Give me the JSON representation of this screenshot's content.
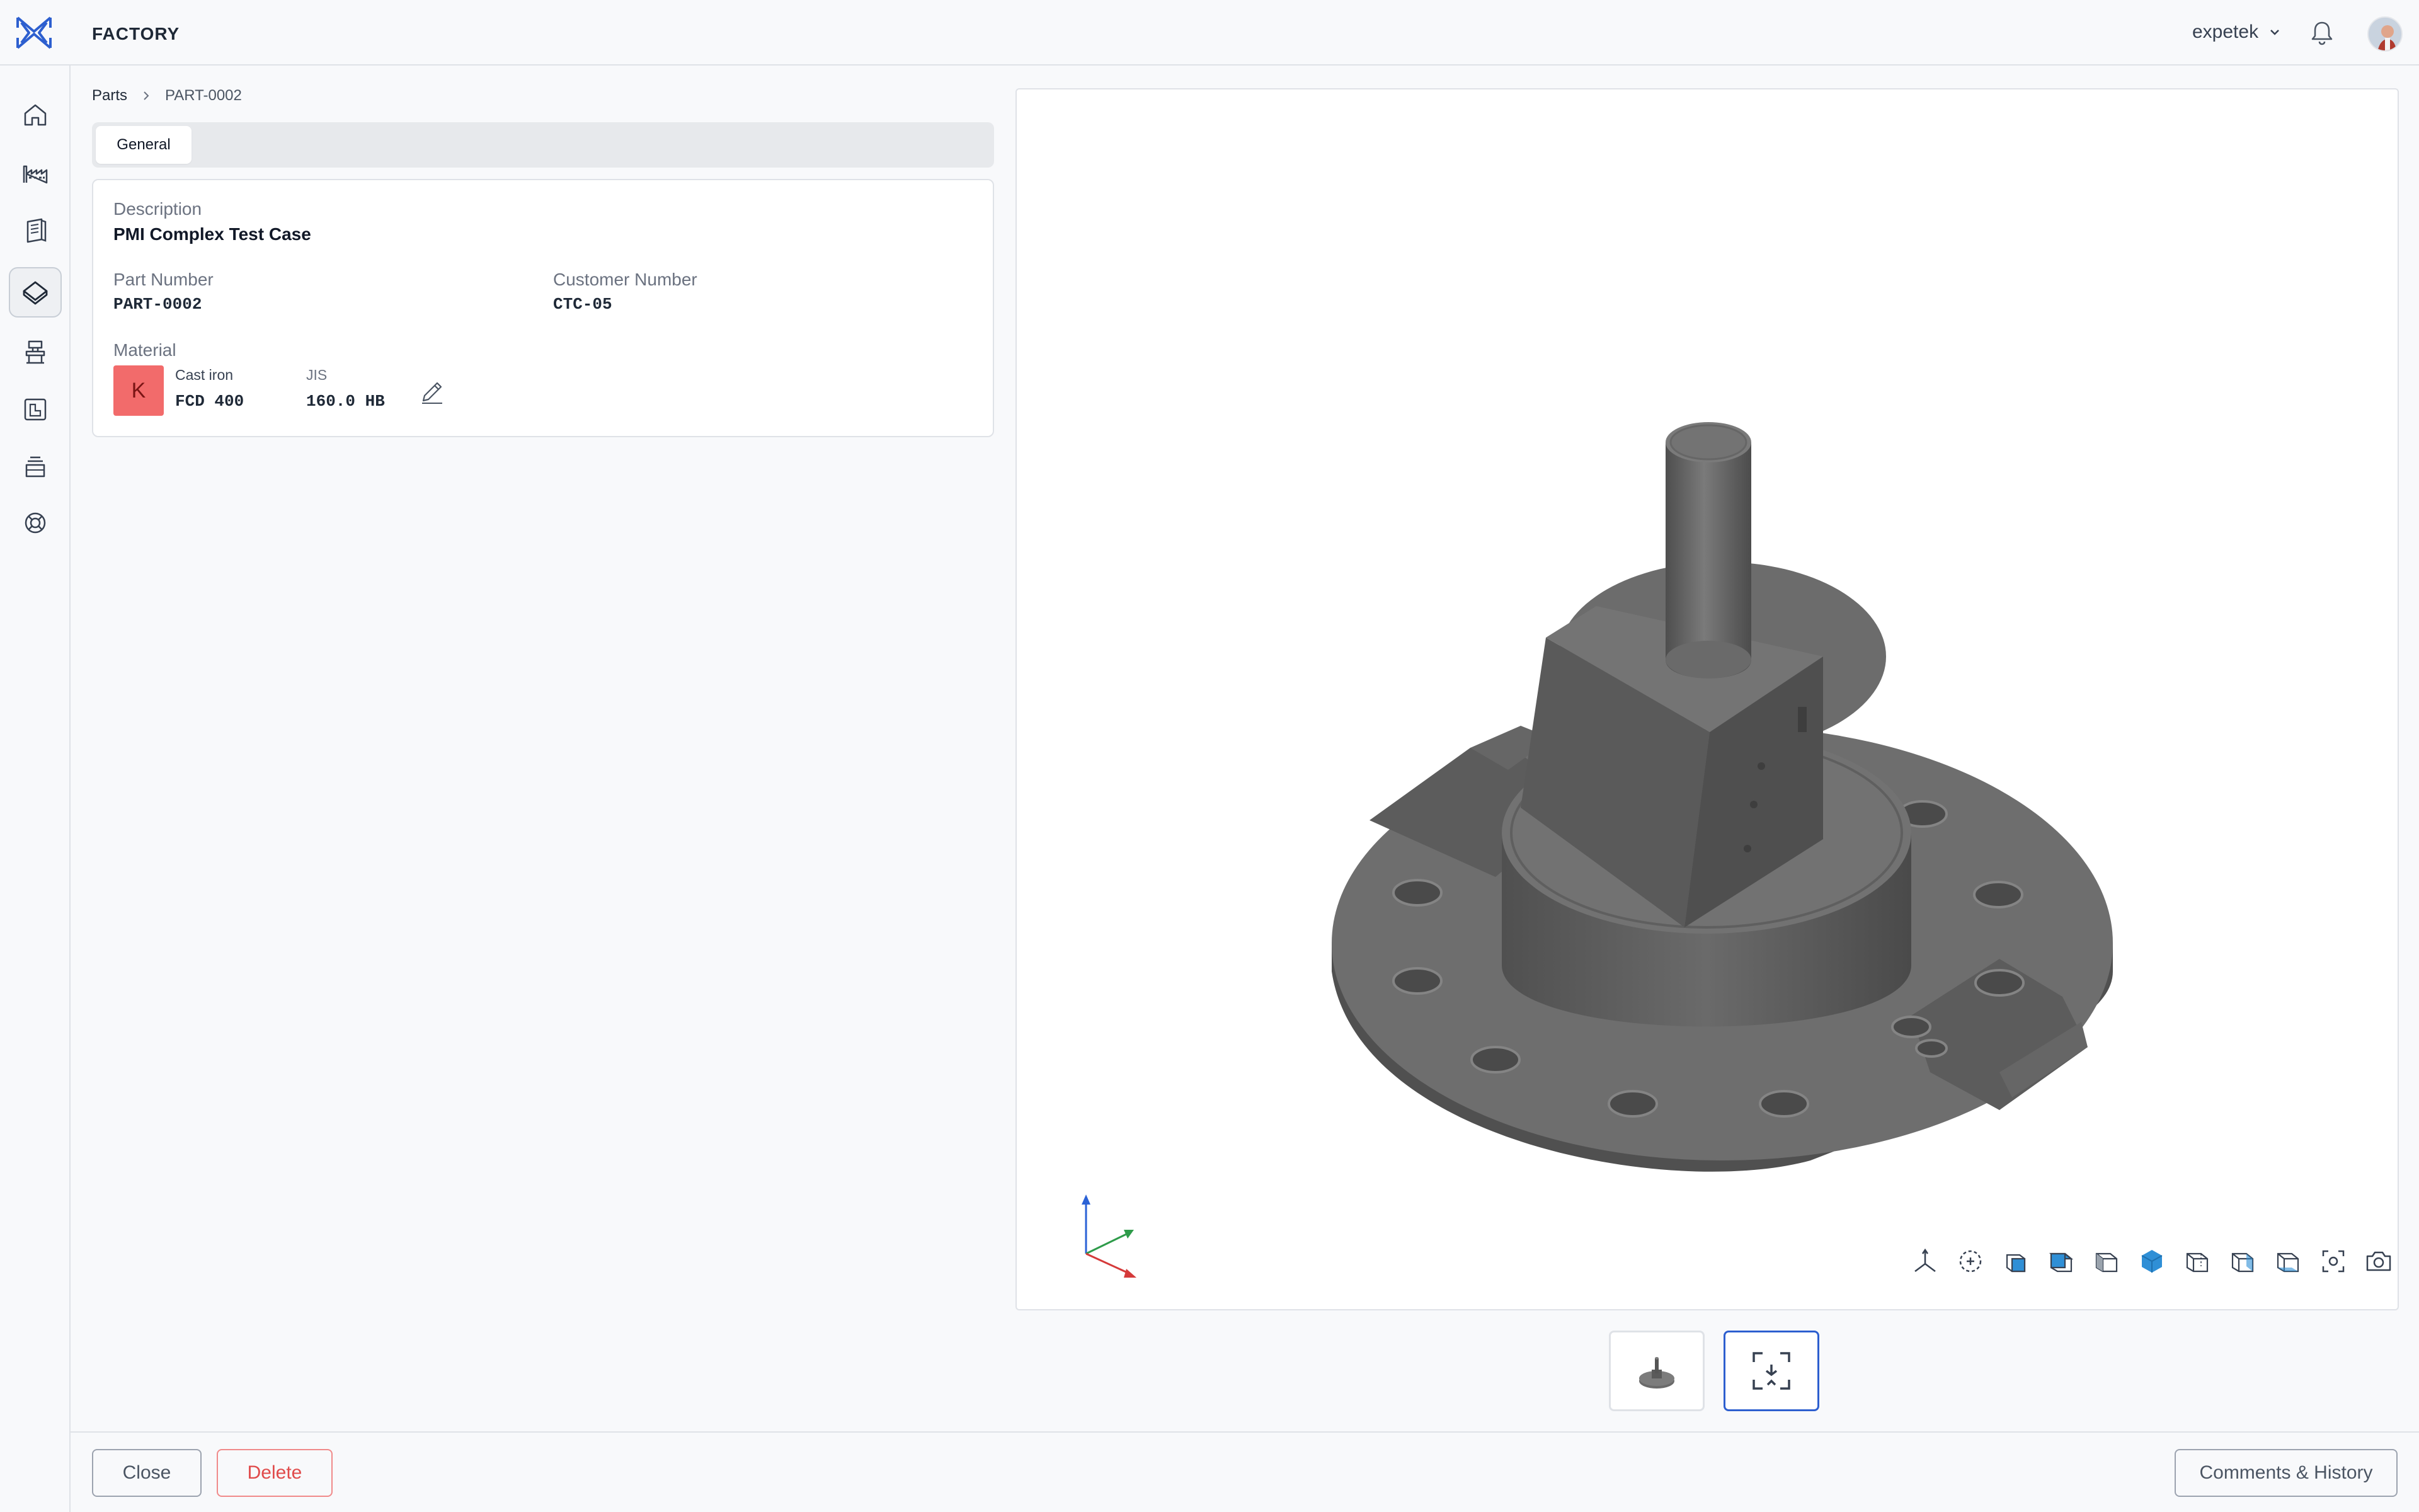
{
  "app": {
    "title": "FACTORY"
  },
  "user": {
    "name": "expetek"
  },
  "nav": {
    "items": [
      {
        "icon": "home-icon"
      },
      {
        "icon": "factory-icon"
      },
      {
        "icon": "document-stack-icon"
      },
      {
        "icon": "part-icon",
        "active": true
      },
      {
        "icon": "machine-icon"
      },
      {
        "icon": "drawing-icon"
      },
      {
        "icon": "inventory-icon"
      },
      {
        "icon": "support-icon"
      }
    ]
  },
  "breadcrumb": {
    "root": "Parts",
    "current": "PART-0002"
  },
  "tabs": [
    {
      "label": "General",
      "active": true
    }
  ],
  "part": {
    "description_label": "Description",
    "description": "PMI Complex Test Case",
    "part_number_label": "Part Number",
    "part_number": "PART-0002",
    "customer_number_label": "Customer Number",
    "customer_number": "CTC-05",
    "material_label": "Material",
    "material": {
      "badge": "K",
      "badge_color": "#f26b6b",
      "group": "Cast iron",
      "grade": "FCD 400",
      "standard": "JIS",
      "hardness": "160.0 HB"
    }
  },
  "viewer": {
    "model_color": "#6b6b6b",
    "accent_color": "#2f8fd6",
    "tools": [
      "axes-icon",
      "fit-view-icon",
      "view-front-icon",
      "view-top-icon",
      "view-right-icon",
      "view-iso-icon",
      "view-back-icon",
      "view-left-icon",
      "view-bottom-icon",
      "focus-icon",
      "screenshot-icon"
    ]
  },
  "thumbnails": [
    {
      "icon": "model-thumbnail-icon",
      "active": false
    },
    {
      "icon": "pmi-view-icon",
      "active": true
    }
  ],
  "actions": {
    "close": "Close",
    "delete": "Delete",
    "comments": "Comments & History"
  }
}
